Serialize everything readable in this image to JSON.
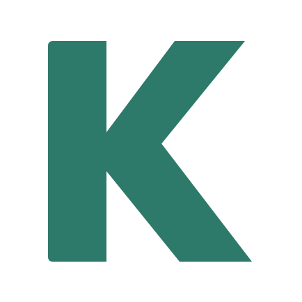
{
  "logo": {
    "letter": "K",
    "icon": "letter-k-logo-icon",
    "color": "#2e7a6a"
  },
  "background_color": "#ffffff"
}
